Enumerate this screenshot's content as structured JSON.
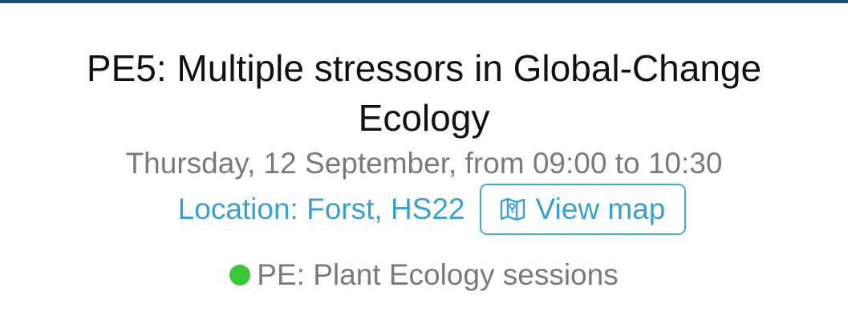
{
  "session": {
    "title": "PE5: Multiple stressors in Global-Change Ecology",
    "datetime": "Thursday, 12 September, from 09:00 to 10:30",
    "location": "Location: Forst, HS22",
    "map_button_label": "View map",
    "map_icon": "map-icon",
    "track": {
      "label": "PE: Plant Ecology sessions",
      "color": "#3cc63c"
    }
  },
  "colors": {
    "top_bar": "#1f4e79",
    "link": "#3aa0cc",
    "muted_text": "#7a7a7a"
  }
}
